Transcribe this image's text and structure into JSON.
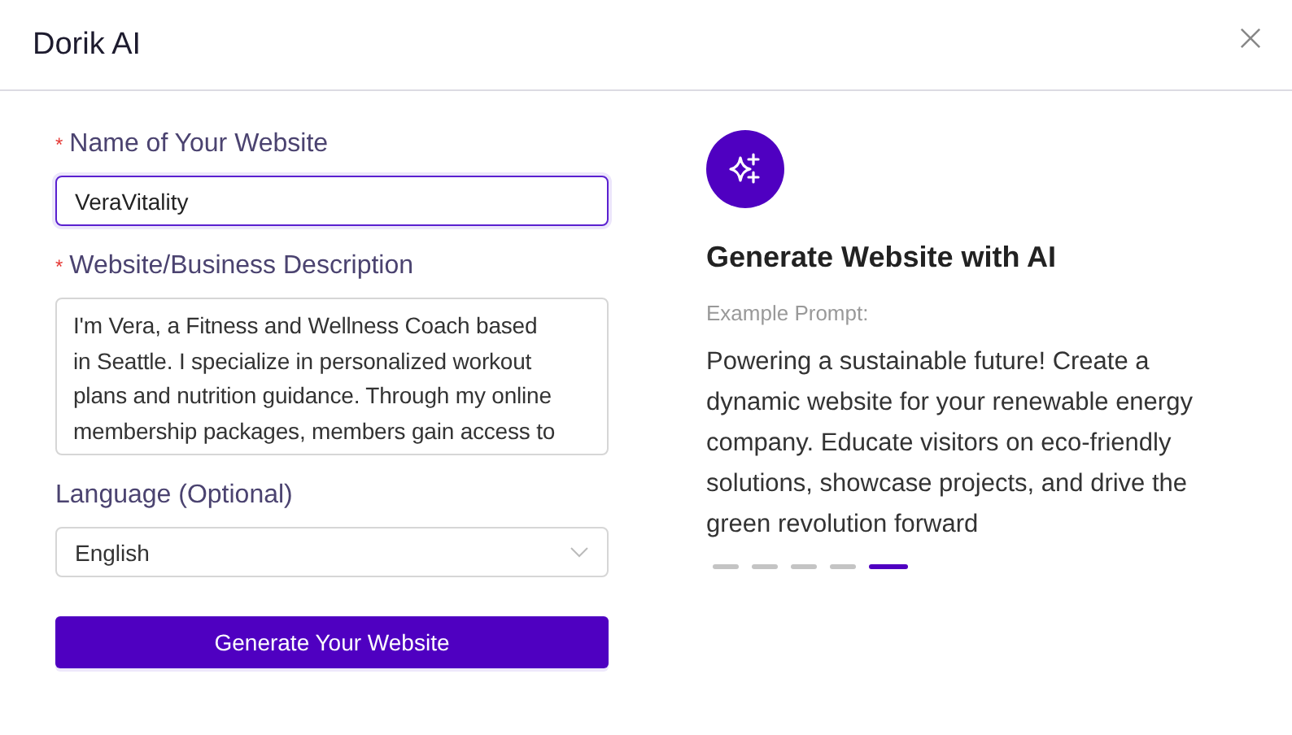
{
  "window": {
    "title": "Dorik AI"
  },
  "form": {
    "fields": [
      {
        "kind": "input",
        "label": "Name of Your Website",
        "required_mark": "*",
        "value": "VeraVitality",
        "focused": true
      },
      {
        "kind": "textarea",
        "label": "Website/Business Description",
        "required_mark": "*",
        "value": "I'm Vera, a Fitness and Wellness Coach based in Seattle. I specialize in personalized workout plans and nutrition guidance. Through my online membership packages, members gain access to",
        "focused": false
      },
      {
        "kind": "select",
        "label": "Language (Optional)",
        "value": "English",
        "focused": false
      }
    ],
    "submit": "Generate Your Website"
  },
  "panel": {
    "title": "Generate Website with AI",
    "prompt_label": "Example Prompt:",
    "prompt": "Powering a sustainable future! Create a dynamic website for your renewable energy company. Educate visitors on eco-friendly solutions, showcase projects, and drive the green revolution forward",
    "dots": [
      {
        "selected": false
      },
      {
        "selected": false
      },
      {
        "selected": false
      },
      {
        "selected": false
      },
      {
        "selected": true
      }
    ]
  }
}
